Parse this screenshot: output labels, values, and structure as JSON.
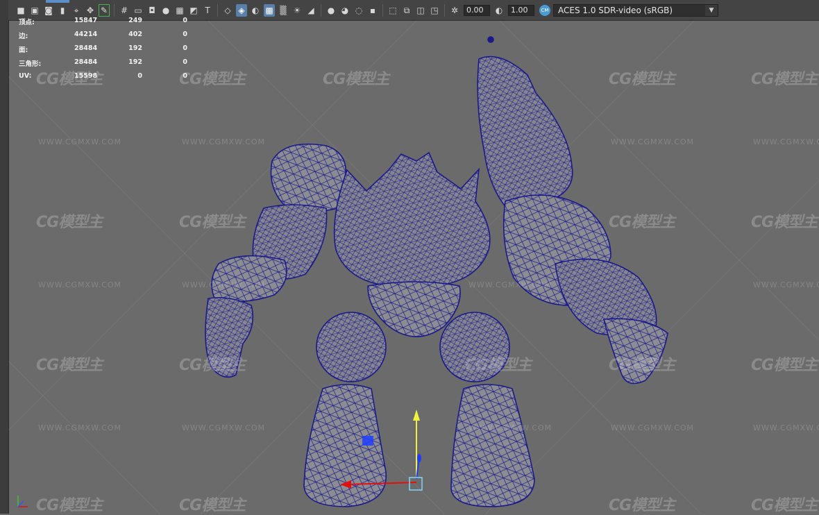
{
  "toolbar": {
    "exposure_value": "0.00",
    "gamma_value": "1.00",
    "color_space": "ACES 1.0 SDR-video (sRGB)",
    "cm_badge": "CM",
    "icons": [
      "camera-icon",
      "camera-lock-icon",
      "camera-bookmark-icon",
      "bookmark-icon",
      "image-plane-icon",
      "move-icon",
      "pencil-icon",
      "grid-icon",
      "film-gate-icon",
      "resolution-gate-icon",
      "gate-mask-icon",
      "field-chart-icon",
      "safe-action-icon",
      "safe-title-icon",
      "wireframe-icon",
      "smooth-shade-icon",
      "shade-wire-icon",
      "wireframe-on-shaded-icon",
      "xray-icon",
      "use-lights-icon",
      "shadows-icon",
      "ambient-occlusion-icon",
      "motion-blur-icon",
      "multisample-aa-icon",
      "depth-of-field-icon",
      "isolate-select-icon",
      "xray-joints-icon",
      "xray-active-icon",
      "backface-icon",
      "exposure-icon",
      "gamma-icon"
    ]
  },
  "hud": {
    "rows": [
      {
        "label": "顶点:",
        "v1": "15847",
        "v2": "249",
        "v3": "0"
      },
      {
        "label": "边:",
        "v1": "44214",
        "v2": "402",
        "v3": "0"
      },
      {
        "label": "面:",
        "v1": "28484",
        "v2": "192",
        "v3": "0"
      },
      {
        "label": "三角形:",
        "v1": "28484",
        "v2": "192",
        "v3": "0"
      },
      {
        "label": "UV:",
        "v1": "15598",
        "v2": "0",
        "v3": "0"
      }
    ]
  },
  "watermark": {
    "logo": "CG模型主",
    "url": "WWW.CGMXW.COM"
  },
  "axis": {
    "x": "x",
    "y": "y",
    "z": "z"
  },
  "colors": {
    "viewport_bg": "#6b6b6b",
    "mesh_fill": "#8a8a90",
    "wire": "#1a1a8a",
    "manip_x": "#e01010",
    "manip_y": "#f0f040",
    "manip_z": "#1e3cff"
  }
}
